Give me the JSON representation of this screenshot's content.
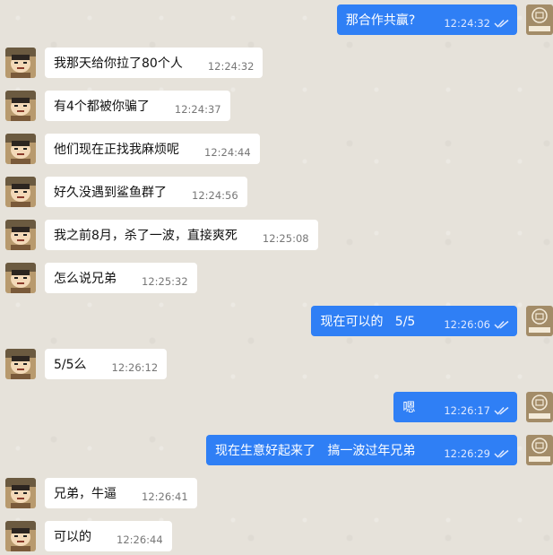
{
  "colors": {
    "background": "#e6e2da",
    "incoming_bubble": "#ffffff",
    "outgoing_bubble": "#2f7ff5",
    "outgoing_time": "#dfe9ff"
  },
  "messages": [
    {
      "dir": "out",
      "text": "那合作共赢?",
      "time": "12:24:32"
    },
    {
      "dir": "in",
      "text": "我那天给你拉了80个人",
      "time": "12:24:32"
    },
    {
      "dir": "in",
      "text": "有4个都被你骗了",
      "time": "12:24:37"
    },
    {
      "dir": "in",
      "text": "他们现在正找我麻烦呢",
      "time": "12:24:44"
    },
    {
      "dir": "in",
      "text": "好久没遇到鲨鱼群了",
      "time": "12:24:56"
    },
    {
      "dir": "in",
      "text": "我之前8月，杀了一波，直接爽死",
      "time": "12:25:08"
    },
    {
      "dir": "in",
      "text": "怎么说兄弟",
      "time": "12:25:32"
    },
    {
      "dir": "out",
      "text": "现在可以的   5/5",
      "time": "12:26:06"
    },
    {
      "dir": "in",
      "text": "5/5么",
      "time": "12:26:12"
    },
    {
      "dir": "out",
      "text": "嗯",
      "time": "12:26:17"
    },
    {
      "dir": "out",
      "text": "现在生意好起来了   搞一波过年兄弟",
      "time": "12:26:29"
    },
    {
      "dir": "in",
      "text": "兄弟，牛逼",
      "time": "12:26:41"
    },
    {
      "dir": "in",
      "text": "可以的",
      "time": "12:26:44"
    }
  ],
  "avatars": {
    "incoming": "cartoon-boy-avatar",
    "outgoing": "seal-stamp-avatar"
  }
}
